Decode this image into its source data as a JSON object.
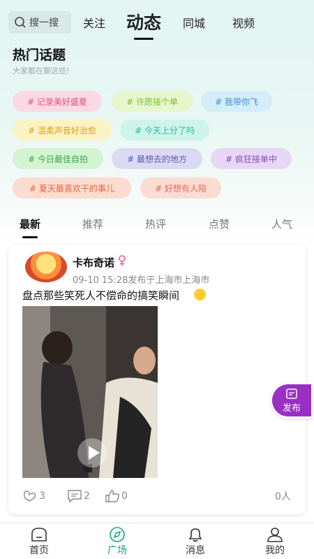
{
  "top_nav": {
    "search_placeholder": "搜一搜",
    "tabs": [
      "关注",
      "动态",
      "同城",
      "视频"
    ],
    "active_tab": "动态"
  },
  "hot_topics": {
    "title": "热门话题",
    "subtitle": "大家都在聊这些!",
    "tags": [
      {
        "label": "# 记录美好盛夏",
        "color": "#e2527a",
        "bg": "#fbd9e4"
      },
      {
        "label": "# 许愿接个单",
        "color": "#7fbf2f",
        "bg": "#e7f6cd"
      },
      {
        "label": "# 我带你飞",
        "color": "#3f8fd6",
        "bg": "#d5ecf9"
      },
      {
        "label": "# 温柔声音好治愈",
        "color": "#d9a414",
        "bg": "#fbf3c3"
      },
      {
        "label": "# 今天上分了吗",
        "color": "#2fb89c",
        "bg": "#cdf3ea"
      },
      {
        "label": "# 今日最佳自拍",
        "color": "#3aa84a",
        "bg": "#d3f3d3"
      },
      {
        "label": "# 最想去的地方",
        "color": "#5a58b8",
        "bg": "#dcdaf3"
      },
      {
        "label": "# 疯狂接单中",
        "color": "#8a4ac0",
        "bg": "#e6d8f4"
      },
      {
        "label": "# 夏天最喜欢干的事儿",
        "color": "#e06a46",
        "bg": "#fbdccf"
      },
      {
        "label": "# 好想有人陪",
        "color": "#e8695a",
        "bg": "#fbdcd3"
      }
    ]
  },
  "feed_filters": {
    "items": [
      "最新",
      "推荐",
      "热评",
      "点赞",
      "人气"
    ],
    "active": "最新"
  },
  "post": {
    "username": "卡布奇诺",
    "meta": "09-10 15:28发布于上海市上海市",
    "text": "盘点那些笑死人不偿命的搞笑瞬间",
    "actions": {
      "gifts": "3",
      "comments": "2",
      "likes": "0"
    },
    "views": "0人"
  },
  "fab": {
    "label": "发布"
  },
  "bottom_nav": {
    "items": [
      {
        "label": "首页",
        "icon": "home-icon"
      },
      {
        "label": "广场",
        "icon": "compass-icon"
      },
      {
        "label": "消息",
        "icon": "bell-icon"
      },
      {
        "label": "我的",
        "icon": "user-icon"
      }
    ],
    "active": "广场"
  },
  "colors": {
    "accent": "#1aa38a",
    "fab": "#9a2fc4"
  }
}
